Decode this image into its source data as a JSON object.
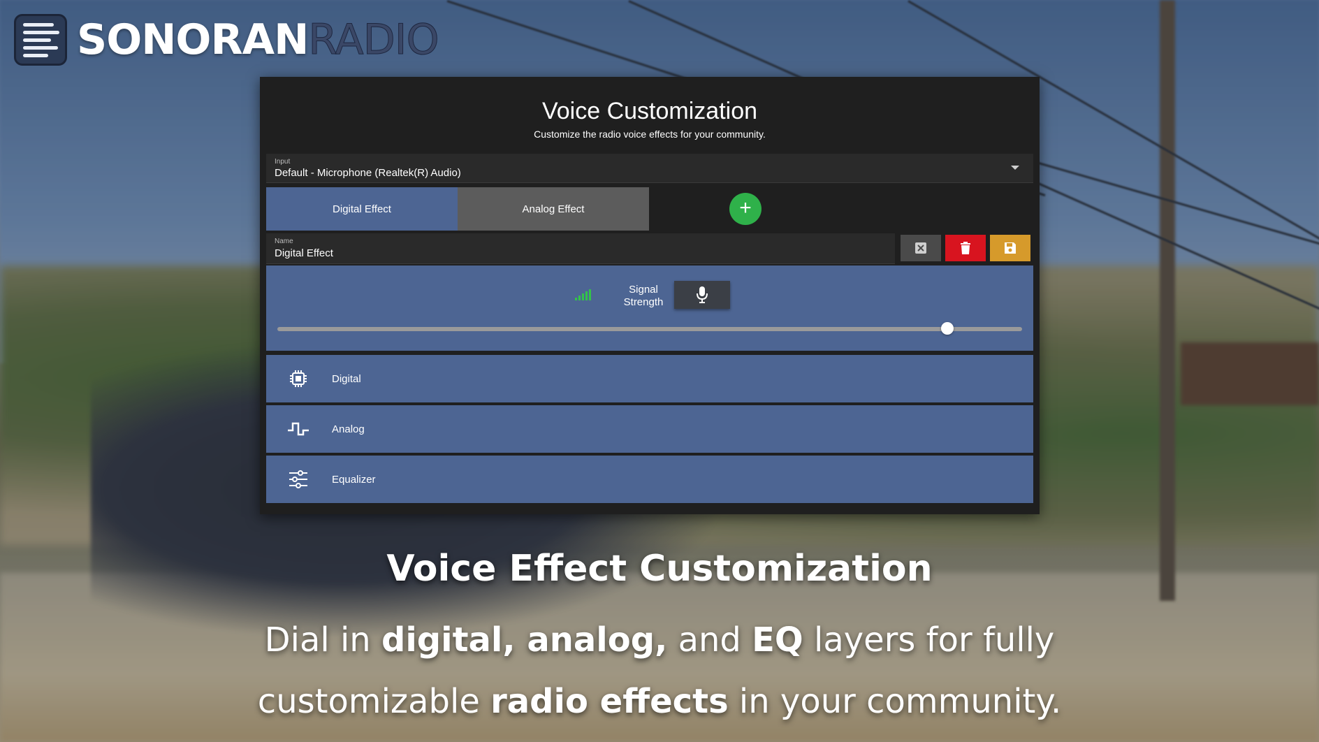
{
  "brand": {
    "name_bold": "SONORAN",
    "name_light": "RADIO"
  },
  "panel": {
    "title": "Voice Customization",
    "subtitle": "Customize the radio voice effects for your community.",
    "input": {
      "label": "Input",
      "value": "Default - Microphone (Realtek(R) Audio)"
    },
    "tabs": [
      {
        "label": "Digital Effect",
        "active": true
      },
      {
        "label": "Analog Effect",
        "active": false
      }
    ],
    "add_icon": "plus-icon",
    "name_field": {
      "label": "Name",
      "value": "Digital Effect"
    },
    "actions": {
      "clear_icon": "close-box-icon",
      "delete_icon": "trash-icon",
      "save_icon": "save-icon"
    },
    "signal": {
      "label_line1": "Signal",
      "label_line2": "Strength",
      "mic_icon": "microphone-icon",
      "slider_value": 0.9
    },
    "sections": [
      {
        "label": "Digital",
        "icon": "chip-icon"
      },
      {
        "label": "Analog",
        "icon": "square-wave-icon"
      },
      {
        "label": "Equalizer",
        "icon": "sliders-icon"
      }
    ]
  },
  "caption": {
    "headline": "Voice Effect Customization",
    "l1_a": "Dial in ",
    "l1_b": "digital, analog,",
    "l1_c": " and ",
    "l1_d": "EQ",
    "l1_e": " layers for fully",
    "l2_a": "customizable ",
    "l2_b": "radio effects",
    "l2_c": " in your community."
  },
  "colors": {
    "panel_bg": "#1f1f1f",
    "section_bg": "#4d6593",
    "tab_inactive": "#5c5c5c",
    "add_green": "#2fb14a",
    "delete_red": "#d8141f",
    "save_orange": "#d69a2b",
    "signal_green": "#33c24a"
  }
}
